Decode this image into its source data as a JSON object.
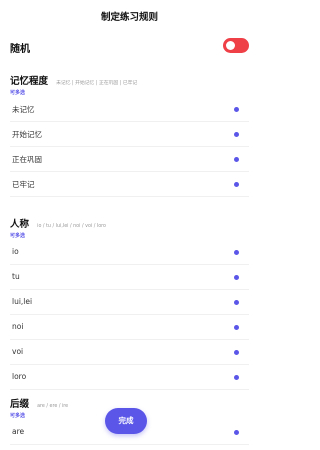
{
  "header": {
    "title": "制定练习规则"
  },
  "random": {
    "label": "随机",
    "enabled": true
  },
  "sections": [
    {
      "title": "记忆程度",
      "hint": "未记忆 | 开始记忆 | 正在巩固 | 已牢记",
      "multi_label": "可多选",
      "options": [
        "未记忆",
        "开始记忆",
        "正在巩固",
        "已牢记"
      ]
    },
    {
      "title": "人称",
      "hint": "io / tu / lui,lei / noi / voi / loro",
      "multi_label": "可多选",
      "options": [
        "io",
        "tu",
        "lui,lei",
        "noi",
        "voi",
        "loro"
      ]
    },
    {
      "title": "后缀",
      "hint": "are / ere / ire",
      "multi_label": "可多选",
      "options": [
        "are"
      ]
    }
  ],
  "footer": {
    "done_label": "完成"
  },
  "colors": {
    "accent": "#5b56e8",
    "toggle_on": "#ef3f47"
  }
}
